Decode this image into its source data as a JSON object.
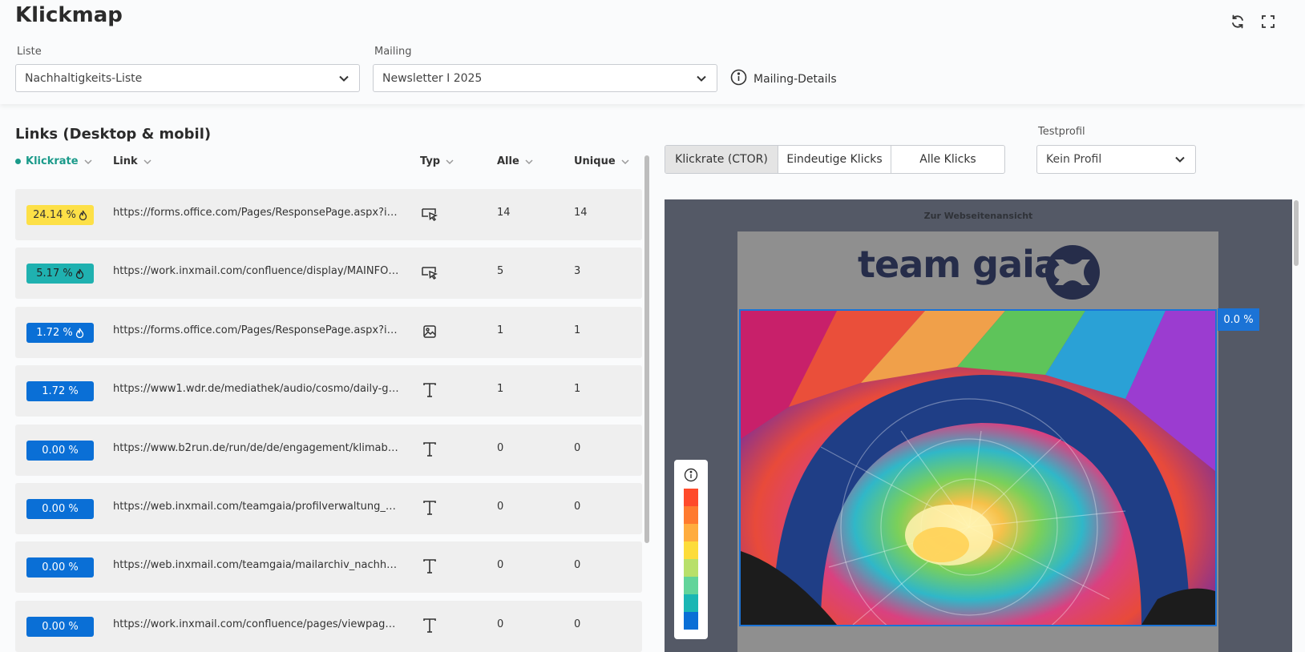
{
  "header": {
    "title": "Klickmap",
    "liste_label": "Liste",
    "liste_value": "Nachhaltigkeits-Liste",
    "mailing_label": "Mailing",
    "mailing_value": "Newsletter I 2025",
    "details_label": "Mailing-Details",
    "icons": [
      "refresh-icon",
      "fullscreen-icon"
    ]
  },
  "links": {
    "title": "Links (Desktop & mobil)",
    "columns": {
      "rate": "Klickrate",
      "link": "Link",
      "type": "Typ",
      "all": "Alle",
      "unique": "Unique"
    },
    "rows": [
      {
        "rate": "24.14 %",
        "hot": true,
        "badge_bg": "#fde047",
        "badge_fg": "#333333",
        "link": "https://forms.office.com/Pages/ResponsePage.aspx?id=...",
        "type": "button-icon",
        "all": "14",
        "unique": "14"
      },
      {
        "rate": "5.17 %",
        "hot": true,
        "badge_bg": "#1fb1b0",
        "badge_fg": "#222222",
        "link": "https://work.inxmail.com/confluence/display/MAINFOS...",
        "type": "button-icon",
        "all": "5",
        "unique": "3"
      },
      {
        "rate": "1.72 %",
        "hot": true,
        "badge_bg": "#0a6fd6",
        "badge_fg": "#ffffff",
        "link": "https://forms.office.com/Pages/ResponsePage.aspx?id=...",
        "type": "image-icon",
        "all": "1",
        "unique": "1"
      },
      {
        "rate": "1.72 %",
        "hot": false,
        "badge_bg": "#0a6fd6",
        "badge_fg": "#ffffff",
        "link": "https://www1.wdr.de/mediathek/audio/cosmo/daily-go...",
        "type": "text-icon",
        "all": "1",
        "unique": "1"
      },
      {
        "rate": "0.00 %",
        "hot": false,
        "badge_bg": "#0a6fd6",
        "badge_fg": "#ffffff",
        "link": "https://www.b2run.de/run/de/de/engagement/klimabe...",
        "type": "text-icon",
        "all": "0",
        "unique": "0"
      },
      {
        "rate": "0.00 %",
        "hot": false,
        "badge_bg": "#0a6fd6",
        "badge_fg": "#ffffff",
        "link": "https://web.inxmail.com/teamgaia/profilverwaltung_na...",
        "type": "text-icon",
        "all": "0",
        "unique": "0"
      },
      {
        "rate": "0.00 %",
        "hot": false,
        "badge_bg": "#0a6fd6",
        "badge_fg": "#ffffff",
        "link": "https://web.inxmail.com/teamgaia/mailarchiv_nachhalt...",
        "type": "text-icon",
        "all": "0",
        "unique": "0"
      },
      {
        "rate": "0.00 %",
        "hot": false,
        "badge_bg": "#0a6fd6",
        "badge_fg": "#ffffff",
        "link": "https://work.inxmail.com/confluence/pages/viewpage....",
        "type": "text-icon",
        "all": "0",
        "unique": "0"
      }
    ]
  },
  "view": {
    "tabs": [
      "Klickrate (CTOR)",
      "Eindeutige Klicks",
      "Alle Klicks"
    ],
    "active_tab": 0,
    "testprofil_label": "Testprofil",
    "testprofil_value": "Kein Profil"
  },
  "preview": {
    "web_link": "Zur Webseitenansicht",
    "logo": "team gaia",
    "hero_rate": "0.0 %",
    "legend_colors": [
      "#ff4a2a",
      "#ff7a2e",
      "#ffac3e",
      "#fddc3a",
      "#b8e06a",
      "#62d49a",
      "#1ab6b4",
      "#0a6fd6"
    ]
  }
}
